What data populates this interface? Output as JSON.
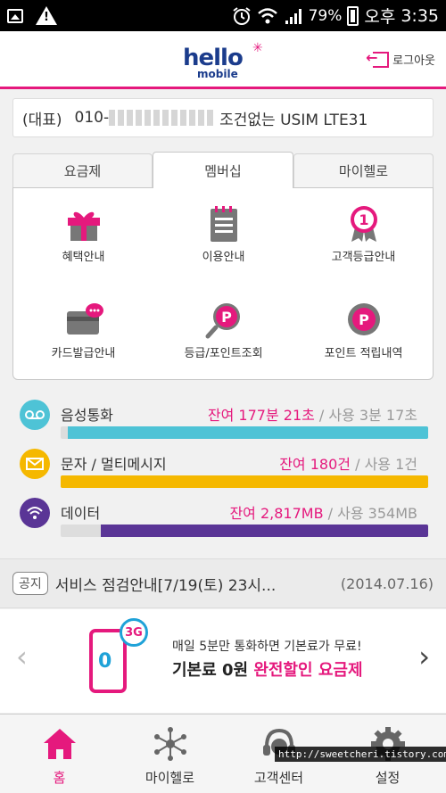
{
  "status_bar": {
    "battery": "79%",
    "ampm": "오후",
    "time": "3:35"
  },
  "header": {
    "logo_main": "hello",
    "logo_sub": "mobile",
    "logout_label": "로그아웃"
  },
  "account": {
    "prefix": "(대표)",
    "number_start": "010-",
    "plan": "조건없는 USIM LTE31"
  },
  "tabs": [
    {
      "label": "요금제",
      "active": false
    },
    {
      "label": "멤버십",
      "active": true
    },
    {
      "label": "마이헬로",
      "active": false
    }
  ],
  "menu": [
    {
      "label": "혜택안내",
      "icon": "gift-icon"
    },
    {
      "label": "이용안내",
      "icon": "notepad-icon"
    },
    {
      "label": "고객등급안내",
      "icon": "medal-icon"
    },
    {
      "label": "카드발급안내",
      "icon": "card-icon"
    },
    {
      "label": "등급/포인트조회",
      "icon": "point-search-icon"
    },
    {
      "label": "포인트 적립내역",
      "icon": "point-badge-icon"
    }
  ],
  "usage": [
    {
      "label": "음성통화",
      "remaining": "잔여 177분 21초",
      "used": "사용 3분 17초",
      "fill_pct": 98,
      "color": "#4ec3d6",
      "icon": "voicemail-icon"
    },
    {
      "label": "문자 / 멀티메시지",
      "remaining": "잔여 180건",
      "used": "사용 1건",
      "fill_pct": 100,
      "color": "#f5b800",
      "icon": "envelope-icon"
    },
    {
      "label": "데이터",
      "remaining": "잔여 2,817MB",
      "used": "사용 354MB",
      "fill_pct": 89,
      "color": "#5a3596",
      "icon": "wifi-icon"
    }
  ],
  "notice": {
    "tag": "공지",
    "text": "서비스 점검안내[7/19(토) 23시...",
    "date": "(2014.07.16)"
  },
  "banner": {
    "badge": "3G",
    "line1": "매일 5분만 통화하면 기본료가 무료!",
    "line2_a": "기본료 0원 ",
    "line2_b": "완전할인 요금제"
  },
  "bottom_nav": [
    {
      "label": "홈",
      "active": true,
      "icon": "home-icon"
    },
    {
      "label": "마이헬로",
      "active": false,
      "icon": "network-icon"
    },
    {
      "label": "고객센터",
      "active": false,
      "icon": "headset-icon"
    },
    {
      "label": "설정",
      "active": false,
      "icon": "gear-icon"
    }
  ],
  "watermark": "http://sweetcheri.tistory.com",
  "colors": {
    "accent": "#e5197d",
    "brand_blue": "#1b3c8c"
  }
}
